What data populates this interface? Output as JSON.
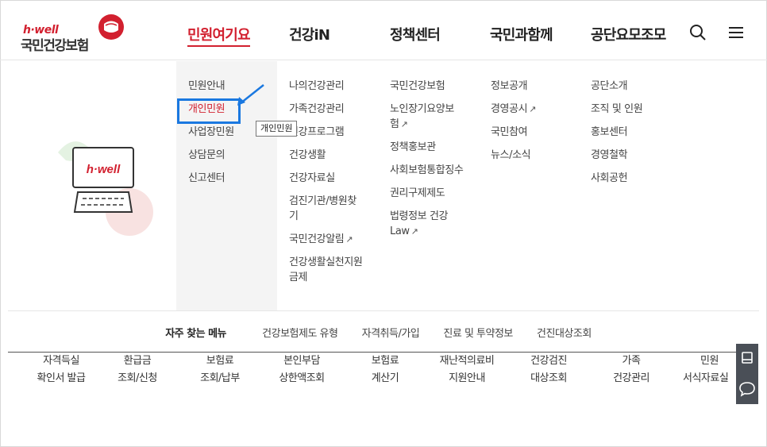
{
  "header": {
    "logo_brand": "h·well",
    "logo_name": "국민건강보험",
    "nav": [
      {
        "label": "민원여기요",
        "active": true
      },
      {
        "label": "건강iN",
        "active": false
      },
      {
        "label": "정책센터",
        "active": false
      },
      {
        "label": "국민과함께",
        "active": false
      },
      {
        "label": "공단요모조모",
        "active": false
      }
    ],
    "search_icon": "search-icon",
    "menu_icon": "hamburger-menu-icon"
  },
  "illustration": {
    "monitor_text": "h·well"
  },
  "mega_menu": {
    "col1": [
      "민원안내",
      "개인민원",
      "사업장민원",
      "상담문의",
      "신고센터"
    ],
    "col2": [
      "나의건강관리",
      "가족건강관리",
      "건강프로그램",
      "건강생활",
      "건강자료실",
      "검진기관/병원찾기",
      "국민건강알림",
      "건강생활실천지원금제"
    ],
    "col3": [
      "국민건강보험",
      "노인장기요양보험",
      "정책홍보관",
      "사회보험통합징수",
      "권리구제제도",
      "법령정보 건강Law"
    ],
    "col4": [
      "정보공개",
      "경영공시",
      "국민참여",
      "뉴스/소식"
    ],
    "col5": [
      "공단소개",
      "조직 및 인원",
      "홍보센터",
      "경영철학",
      "사회공헌"
    ]
  },
  "tooltip": "개인민원",
  "frequent": {
    "title": "자주 찾는 메뉴",
    "items": [
      "건강보험제도 유형",
      "자격취득/가입",
      "진료 및 투약정보",
      "건진대상조회"
    ]
  },
  "quick": [
    {
      "line1": "자격득실",
      "line2": "확인서 발급"
    },
    {
      "line1": "환급금",
      "line2": "조회/신청"
    },
    {
      "line1": "보험료",
      "line2": "조회/납부"
    },
    {
      "line1": "본인부담",
      "line2": "상한액조회"
    },
    {
      "line1": "보험료",
      "line2": "계산기"
    },
    {
      "line1": "재난적의료비",
      "line2": "지원안내"
    },
    {
      "line1": "건강검진",
      "line2": "대상조회"
    },
    {
      "line1": "가족",
      "line2": "건강관리"
    },
    {
      "line1": "민원",
      "line2": "서식자료실"
    }
  ],
  "colors": {
    "accent": "#d2202f",
    "highlight": "#1a78e0"
  }
}
